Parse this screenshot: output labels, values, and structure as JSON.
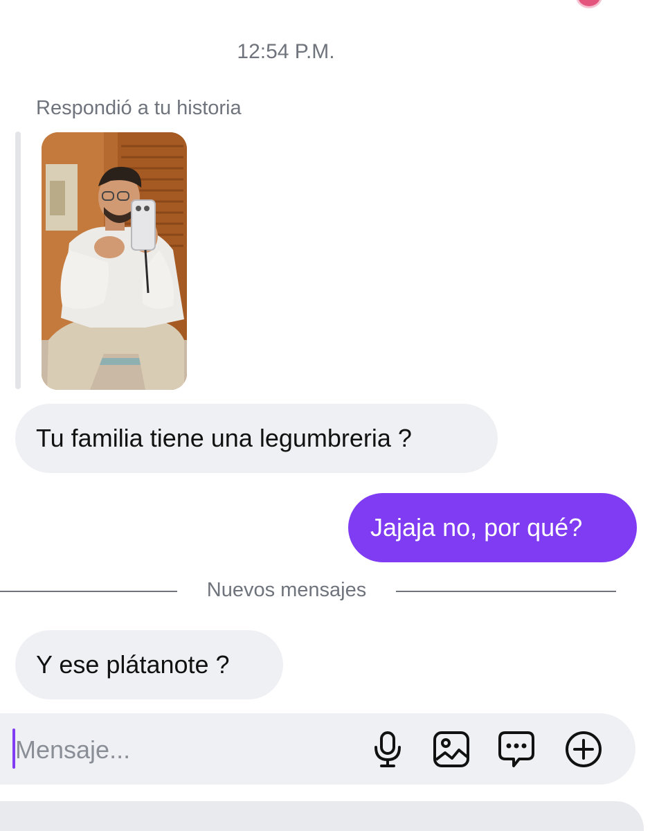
{
  "conversation": {
    "timestamp": "12:54 P.M.",
    "story_reply_label": "Respondió a tu historia",
    "messages": [
      {
        "direction": "incoming",
        "text": "Tu familia tiene una legumbreria ?"
      },
      {
        "direction": "outgoing",
        "text": "Jajaja no, por qué?"
      },
      {
        "direction": "incoming",
        "text": "Y ese plátanote ?"
      }
    ],
    "new_messages_divider": "Nuevos mensajes"
  },
  "composer": {
    "placeholder": "Mensaje...",
    "value": "",
    "icons": [
      "microphone-icon",
      "gallery-icon",
      "sticker-chat-icon",
      "add-circle-icon"
    ]
  },
  "colors": {
    "outgoing_bubble": "#7f3cf3",
    "incoming_bubble": "#eff0f4",
    "muted_text": "#6f737b",
    "cursor": "#7f3cf3"
  }
}
